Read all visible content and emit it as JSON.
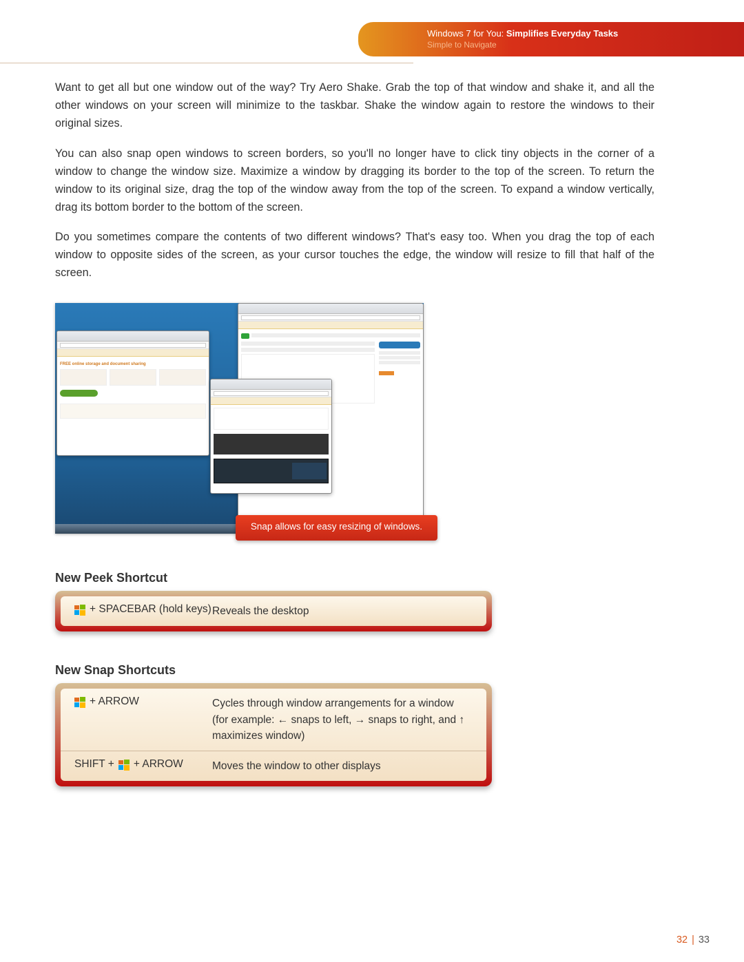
{
  "header": {
    "book_prefix": "Windows 7 for You: ",
    "chapter": "Simplifies Everyday Tasks",
    "subchapter": "Simple to Navigate"
  },
  "paragraphs": [
    "Want to get all but one window out of the way? Try Aero Shake. Grab the top of that window and shake it, and all the other windows on your screen will minimize to the taskbar. Shake the window again to restore the windows to their original sizes.",
    "You can also snap open windows to screen borders, so you'll no longer have to click tiny objects in the corner of a window to change the window size. Maximize a window by dragging its border to the top of the screen. To return the window to its original size, drag the top of the window away from the top of the screen. To expand a window vertically, drag its bottom border to the bottom of the screen.",
    "Do you sometimes compare the contents of two different windows? That's easy too. When you drag the top of each window to opposite sides of the screen, as your cursor touches the edge, the window will resize to fill that half of the screen."
  ],
  "figure": {
    "caption": "Snap allows for easy resizing of windows."
  },
  "sections": [
    {
      "title": "New Peek Shortcut",
      "rows": [
        {
          "key_parts": [
            {
              "icon": "win"
            },
            {
              "text": " + SPACEBAR (hold keys)"
            }
          ],
          "desc": "Reveals the desktop"
        }
      ]
    },
    {
      "title": "New Snap Shortcuts",
      "rows": [
        {
          "key_parts": [
            {
              "icon": "win"
            },
            {
              "text": " + ARROW"
            }
          ],
          "desc": "Cycles through window arrangements for a window (for example: ← snaps to left, → snaps to right, and ↑ maximizes window)"
        },
        {
          "key_parts": [
            {
              "text": "SHIFT + "
            },
            {
              "icon": "win"
            },
            {
              "text": " + ARROW"
            }
          ],
          "desc": "Moves the window to other displays"
        }
      ]
    }
  ],
  "pager": {
    "left": "32",
    "right": "33"
  }
}
